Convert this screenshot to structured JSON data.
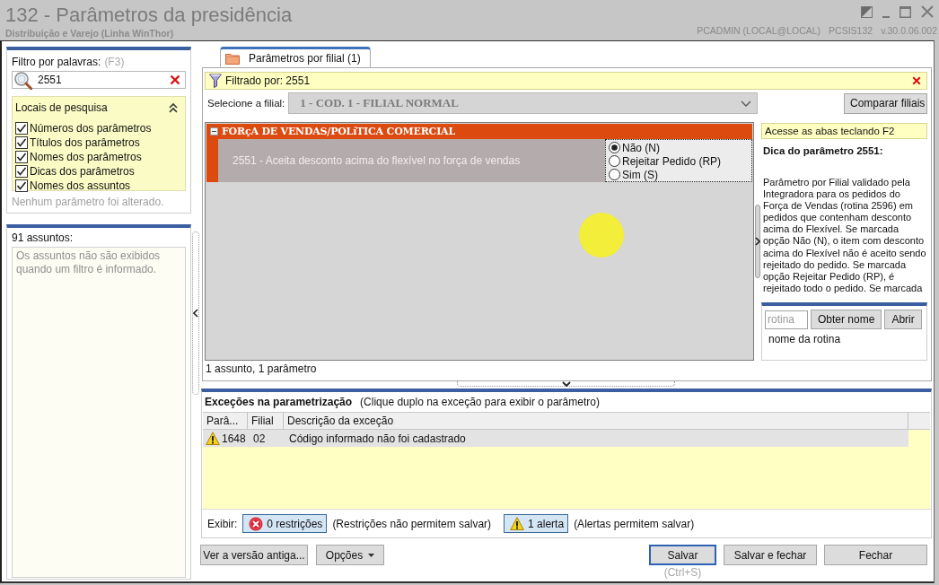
{
  "window": {
    "title": "132 - Parâmetros da presidência",
    "subtitle": "Distribuição e Varejo (Linha WinThor)",
    "user": "PCADMIN (LOCAL@LOCAL)",
    "program": "PCSIS132",
    "version": "v.30.0.06.002"
  },
  "filter_panel": {
    "label": "Filtro por palavras:",
    "shortcut": "(F3)",
    "search": {
      "value": "2551"
    },
    "search_places": {
      "title": "Locais de pesquisa",
      "expanded": true,
      "items": [
        {
          "label": "Números dos parâmetros",
          "checked": true
        },
        {
          "label": "Títulos dos parâmetros",
          "checked": true
        },
        {
          "label": "Nomes dos parâmetros",
          "checked": true
        },
        {
          "label": "Dicas dos parâmetros",
          "checked": true
        },
        {
          "label": "Nomes dos assuntos",
          "checked": true
        }
      ]
    },
    "status": "Nenhum parâmetro foi alterado."
  },
  "subjects_panel": {
    "title": "91 assuntos:",
    "message": "Os assuntos não são exibidos quando um filtro é informado."
  },
  "tabs": [
    {
      "label": "Parâmetros por filial (1)",
      "selected": true
    }
  ],
  "filter_bar": {
    "text": "Filtrado por: 2551"
  },
  "branch": {
    "label": "Selecione a filial:",
    "value": "1 - COD. 1 - FILIAL NORMAL",
    "disabled": true
  },
  "compare_button": "Comparar filiais",
  "groups": [
    {
      "title": "FORçA DE VENDAS/POLíTICA COMERCIAL",
      "expanded": true,
      "parameters": [
        {
          "label": "2551 - Aceita desconto acima do flexível no força de vendas",
          "options": [
            {
              "label": "Não (N)",
              "selected": true
            },
            {
              "label": "Rejeitar Pedido (RP)",
              "selected": false
            },
            {
              "label": "Sim (S)",
              "selected": false
            }
          ]
        }
      ]
    }
  ],
  "hint_panel": {
    "shortcut_hint": "Acesse as abas teclando F2",
    "title": "Dica do parâmetro 2551:",
    "text": "Parâmetro por Filial validado pela Integradora para os pedidos do Força de Vendas (rotina 2596) em pedidos que contenham desconto acima do Flexível. Se marcada opção Não (N), o item com desconto acima do Flexível não é aceito sendo rejeitado do pedido. Se marcada opção Rejeitar Pedido (RP), é rejeitado todo o pedido. Se marcada"
  },
  "routine": {
    "placeholder": "rotina",
    "buttons": [
      "Obter nome",
      "Abrir"
    ],
    "name": "nome da rotina"
  },
  "summary": "1 assunto, 1 parâmetro",
  "exceptions": {
    "title": "Exceções na parametrização",
    "hint": "(Clique duplo na exceção para exibir o parâmetro)",
    "columns": [
      "Parâ...",
      "Filial",
      "Descrição da exceção"
    ],
    "rows": [
      {
        "kind": "alert",
        "selected": true,
        "cells": [
          "1648",
          "02",
          "Código informado não foi cadastrado"
        ]
      }
    ],
    "show_label": "Exibir:",
    "toggles": [
      {
        "kind": "restriction",
        "label": "0 restrições",
        "note": "(Restrições não permitem salvar)",
        "on": true
      },
      {
        "kind": "alert",
        "label": "1 alerta",
        "note": "(Alertas permitem salvar)",
        "on": true
      }
    ]
  },
  "left_buttons": [
    {
      "label": "Ver a versão antiga...",
      "kind": "plain"
    },
    {
      "label": "Opções",
      "kind": "menu"
    }
  ],
  "right_buttons": [
    {
      "label": "Salvar",
      "kind": "default",
      "shortcut": "(Ctrl+S)"
    },
    {
      "label": "Salvar e fechar",
      "kind": "plain"
    },
    {
      "label": "Fechar",
      "kind": "plain"
    }
  ]
}
